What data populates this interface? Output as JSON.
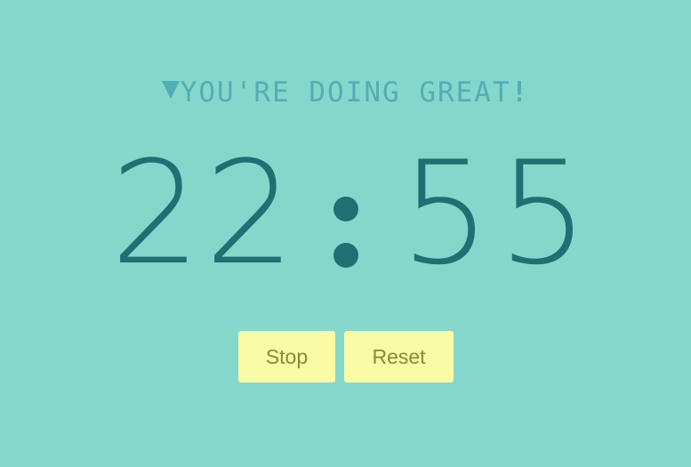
{
  "message": {
    "text": "YOU'RE DOING GREAT",
    "exclaim": "!",
    "icon": "triangle-down-icon"
  },
  "timer": {
    "minutes_tens": "2",
    "minutes_ones": "2",
    "seconds_tens": "5",
    "seconds_ones": "5",
    "separator": ":"
  },
  "controls": {
    "stop_label": "Stop",
    "reset_label": "Reset"
  },
  "colors": {
    "background": "#86d7cb",
    "message": "#52aeb5",
    "digits": "#1f6f73",
    "button_bg": "#f9fba6",
    "button_text": "#8a8a3a"
  }
}
